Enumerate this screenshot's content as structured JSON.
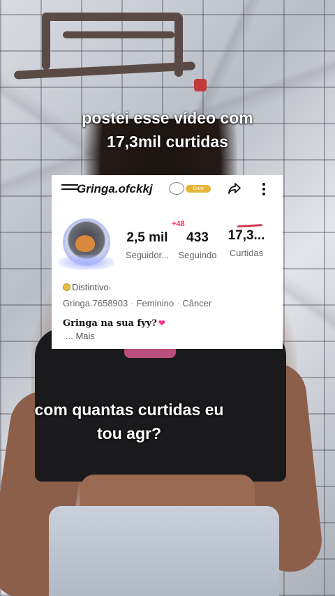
{
  "captions": {
    "top": "postei esse vídeo com 17,3mil curtidas",
    "bottom": "com quantas curtidas eu tou agr?"
  },
  "profile": {
    "username": "Gringa.ofckkj",
    "badge_label": "Ouro",
    "stats": {
      "followers": {
        "value": "2,5 mil",
        "label": "Seguidor..."
      },
      "following": {
        "value": "433",
        "label": "Seguindo"
      },
      "likes": {
        "value": "17,3...",
        "label": "Curtidas"
      }
    },
    "followers_delta": "+48",
    "distinctive_label": "Distintivo",
    "chevron": "›",
    "handle": "Gringa.7658903",
    "gender": "Feminino",
    "sign": "Câncer",
    "separator": "·",
    "bio": "Gringa na sua fyy?",
    "bio_more": "...  Mais"
  },
  "colors": {
    "accent_red": "#ff2a55",
    "heart_pink": "#ff2f8f",
    "badge_gold": "#e7b53a"
  }
}
